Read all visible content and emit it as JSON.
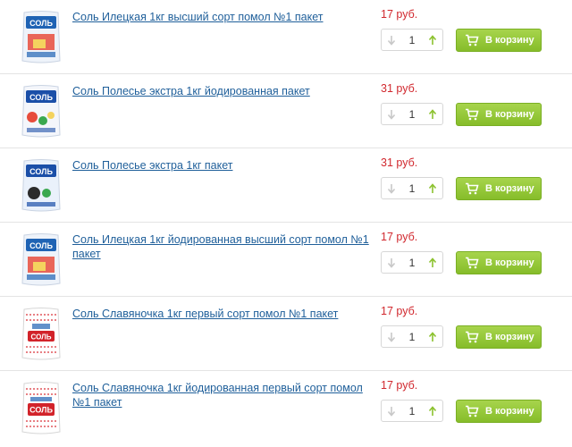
{
  "products": [
    {
      "title": "Соль Илецкая 1кг высший сорт помол №1 пакет",
      "price": "17 руб.",
      "qty": "1",
      "cart_label": "В корзину",
      "pack_label": "СОЛЬ",
      "pack_color": "#1f63b4"
    },
    {
      "title": "Соль Полесье экстра 1кг йодированная пакет",
      "price": "31 руб.",
      "qty": "1",
      "cart_label": "В корзину",
      "pack_label": "СОЛЬ",
      "pack_color": "#1b4fa8"
    },
    {
      "title": "Соль Полесье экстра 1кг пакет",
      "price": "31 руб.",
      "qty": "1",
      "cart_label": "В корзину",
      "pack_label": "СОЛЬ",
      "pack_color": "#1b4fa8"
    },
    {
      "title": "Соль Илецкая 1кг йодированная высший сорт помол №1 пакет",
      "price": "17 руб.",
      "qty": "1",
      "cart_label": "В корзину",
      "pack_label": "СОЛЬ",
      "pack_color": "#1f63b4"
    },
    {
      "title": "Соль Славяночка 1кг первый сорт помол №1 пакет",
      "price": "17 руб.",
      "qty": "1",
      "cart_label": "В корзину",
      "pack_label": "СОЛЬ",
      "pack_color": "#d2232a"
    },
    {
      "title": "Соль Славяночка 1кг йодированная первый сорт помол №1 пакет",
      "price": "17 руб.",
      "qty": "1",
      "cart_label": "В корзину",
      "pack_label": "СОЛЬ",
      "pack_color": "#d2232a"
    }
  ],
  "icons": {
    "decrement": "arrow-down-icon",
    "increment": "arrow-up-icon",
    "cart": "cart-icon"
  },
  "colors": {
    "link": "#1f5f9a",
    "price": "#d1282e",
    "button": "#8cc22f",
    "increment_arrow": "#8cc22f",
    "decrement_arrow": "#c8c8c8"
  }
}
